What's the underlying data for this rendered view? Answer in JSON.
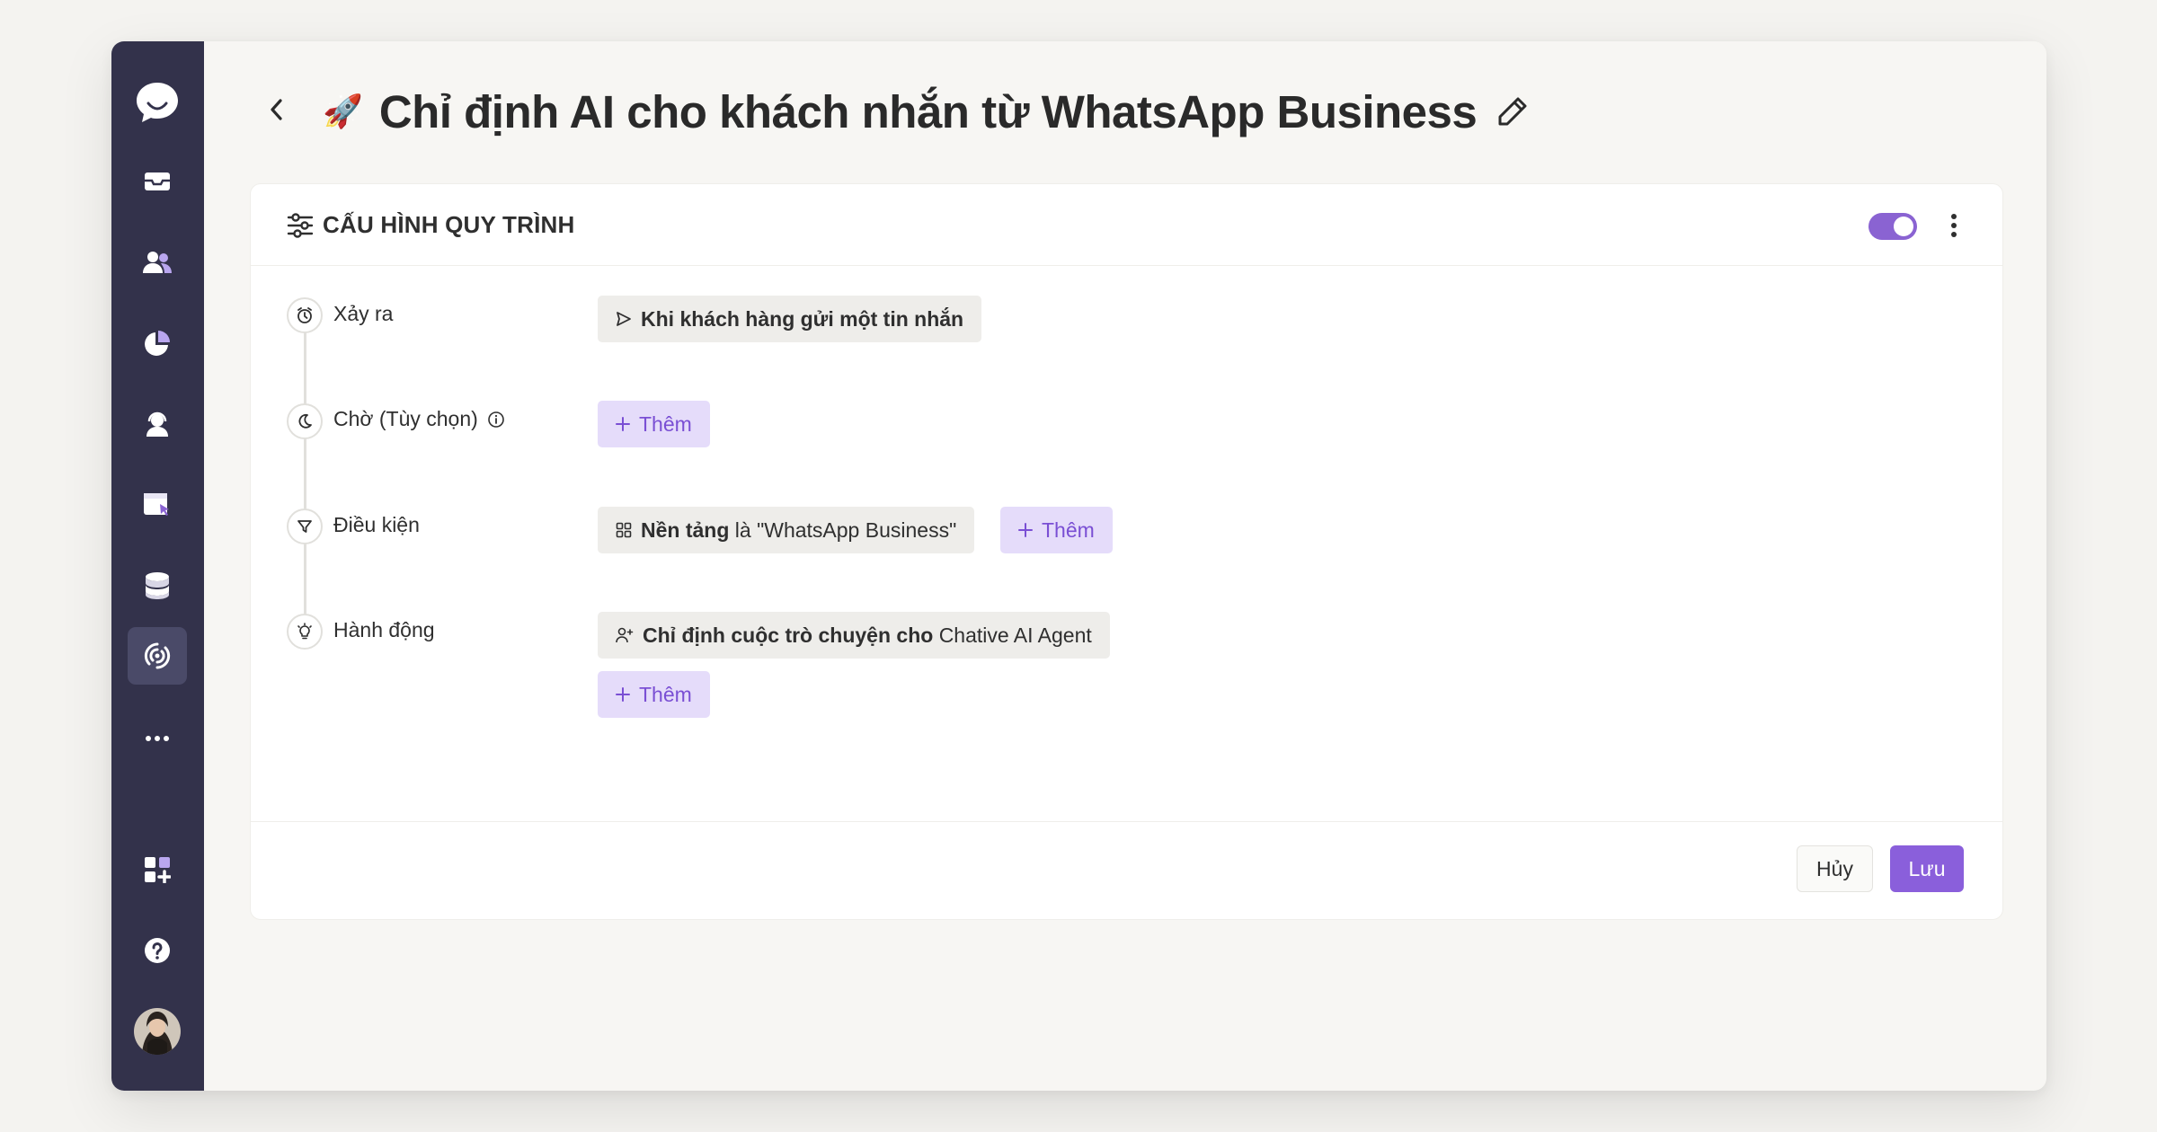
{
  "colors": {
    "sidebar": "#33324b",
    "accent": "#8a63d2",
    "chip_purple_bg": "#e5dcfa",
    "chip_gray_bg": "#eeedea"
  },
  "sidebar": {
    "items": [
      {
        "name": "chat-logo-icon"
      },
      {
        "name": "inbox-icon"
      },
      {
        "name": "contacts-icon"
      },
      {
        "name": "reports-icon"
      },
      {
        "name": "agents-icon"
      },
      {
        "name": "campaigns-icon"
      },
      {
        "name": "database-icon"
      },
      {
        "name": "automation-icon",
        "active": true
      },
      {
        "name": "more-icon"
      },
      {
        "name": "apps-icon"
      },
      {
        "name": "help-icon"
      },
      {
        "name": "avatar"
      }
    ]
  },
  "header": {
    "emoji": "🚀",
    "title": "Chỉ định AI cho khách nhắn từ WhatsApp Business"
  },
  "card": {
    "title": "CẤU HÌNH QUY TRÌNH",
    "enabled": true
  },
  "steps": {
    "trigger": {
      "label": "Xảy ra",
      "value": "Khi khách hàng gửi một tin nhắn"
    },
    "wait": {
      "label": "Chờ (Tùy chọn)",
      "add_label": "Thêm"
    },
    "condition": {
      "label": "Điều kiện",
      "field": "Nền tảng",
      "operator": "là",
      "value": "\"WhatsApp Business\"",
      "add_label": "Thêm"
    },
    "action": {
      "label": "Hành động",
      "action_name": "Chỉ định cuộc trò chuyện cho",
      "target": "Chative AI Agent",
      "add_label": "Thêm"
    }
  },
  "footer": {
    "cancel_label": "Hủy",
    "save_label": "Lưu"
  }
}
